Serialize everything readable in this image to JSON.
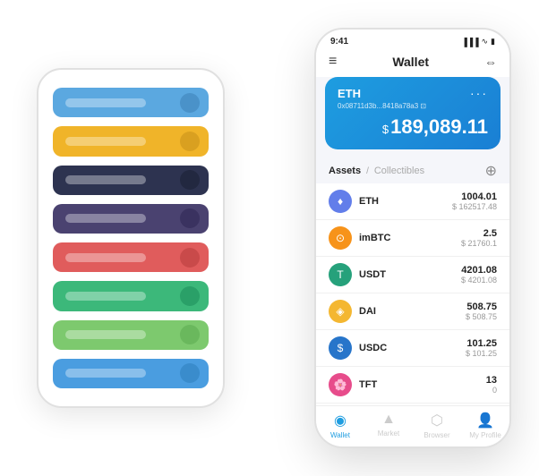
{
  "scene": {
    "bg_phone": {
      "cards": [
        {
          "color": "#5ba8e0",
          "icon_color": "#4a92c9"
        },
        {
          "color": "#f0b429",
          "icon_color": "#d9a020"
        },
        {
          "color": "#2d3350",
          "icon_color": "#222840"
        },
        {
          "color": "#4a4270",
          "icon_color": "#3a3260"
        },
        {
          "color": "#e05c5c",
          "icon_color": "#c94a4a"
        },
        {
          "color": "#3cb87a",
          "icon_color": "#2aa068"
        },
        {
          "color": "#7dc96e",
          "icon_color": "#6ab85d"
        },
        {
          "color": "#4a9de0",
          "icon_color": "#3a8ccc"
        }
      ]
    },
    "fg_phone": {
      "status_bar": {
        "time": "9:41",
        "signal": "▐▐▐",
        "wifi": "WiFi",
        "battery": "🔋"
      },
      "header": {
        "menu_icon": "≡",
        "title": "Wallet",
        "scan_icon": "⇔"
      },
      "wallet_card": {
        "label": "ETH",
        "more_icon": "···",
        "address": "0x08711d3b...8418a78a3",
        "address_suffix": "⊡",
        "balance_symbol": "$",
        "balance": "189,089.11"
      },
      "assets_section": {
        "tab_active": "Assets",
        "divider": "/",
        "tab_inactive": "Collectibles",
        "add_icon": "⊕"
      },
      "assets": [
        {
          "name": "ETH",
          "icon_label": "♦",
          "icon_class": "icon-eth",
          "amount": "1004.01",
          "usd": "$ 162517.48"
        },
        {
          "name": "imBTC",
          "icon_label": "⊙",
          "icon_class": "icon-imbtc",
          "amount": "2.5",
          "usd": "$ 21760.1"
        },
        {
          "name": "USDT",
          "icon_label": "T",
          "icon_class": "icon-usdt",
          "amount": "4201.08",
          "usd": "$ 4201.08"
        },
        {
          "name": "DAI",
          "icon_label": "◈",
          "icon_class": "icon-dai",
          "amount": "508.75",
          "usd": "$ 508.75"
        },
        {
          "name": "USDC",
          "icon_label": "$",
          "icon_class": "icon-usdc",
          "amount": "101.25",
          "usd": "$ 101.25"
        },
        {
          "name": "TFT",
          "icon_label": "🌸",
          "icon_class": "icon-tft",
          "amount": "13",
          "usd": "0"
        }
      ],
      "nav": [
        {
          "icon": "◉",
          "label": "Wallet",
          "active": true
        },
        {
          "icon": "📈",
          "label": "Market",
          "active": false
        },
        {
          "icon": "🌐",
          "label": "Browser",
          "active": false
        },
        {
          "icon": "👤",
          "label": "My Profile",
          "active": false
        }
      ]
    }
  }
}
